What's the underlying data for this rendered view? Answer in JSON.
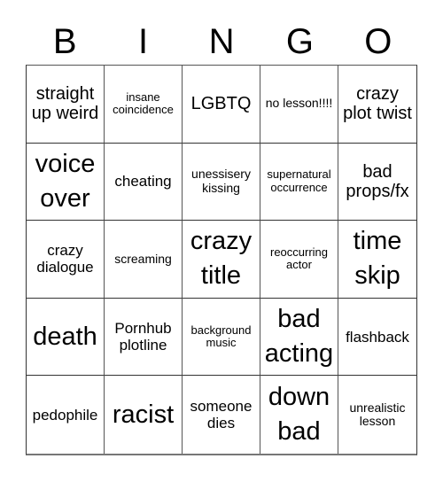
{
  "header": {
    "letters": [
      "B",
      "I",
      "N",
      "G",
      "O"
    ]
  },
  "cells": [
    {
      "text": "straight up weird",
      "size": "lg"
    },
    {
      "text": "insane coincidence",
      "size": "xs"
    },
    {
      "text": "LGBTQ",
      "size": "lg"
    },
    {
      "text": "no lesson!!!!",
      "size": "sm"
    },
    {
      "text": "crazy plot twist",
      "size": "lg"
    },
    {
      "text": "voice over",
      "size": "xl"
    },
    {
      "text": "cheating",
      "size": "md"
    },
    {
      "text": "unessisery kissing",
      "size": "sm"
    },
    {
      "text": "supernatural occurrence",
      "size": "xs"
    },
    {
      "text": "bad props/fx",
      "size": "lg"
    },
    {
      "text": "crazy dialogue",
      "size": "md"
    },
    {
      "text": "screaming",
      "size": "sm"
    },
    {
      "text": "crazy title",
      "size": "xl"
    },
    {
      "text": "reoccurring actor",
      "size": "xs"
    },
    {
      "text": "time skip",
      "size": "xl"
    },
    {
      "text": "death",
      "size": "xl"
    },
    {
      "text": "Pornhub plotline",
      "size": "md"
    },
    {
      "text": "background music",
      "size": "xs"
    },
    {
      "text": "bad acting",
      "size": "xl"
    },
    {
      "text": "flashback",
      "size": "md"
    },
    {
      "text": "pedophile",
      "size": "md"
    },
    {
      "text": "racist",
      "size": "xl"
    },
    {
      "text": "someone dies",
      "size": "md"
    },
    {
      "text": "down bad",
      "size": "xl"
    },
    {
      "text": "unrealistic lesson",
      "size": "sm"
    }
  ]
}
